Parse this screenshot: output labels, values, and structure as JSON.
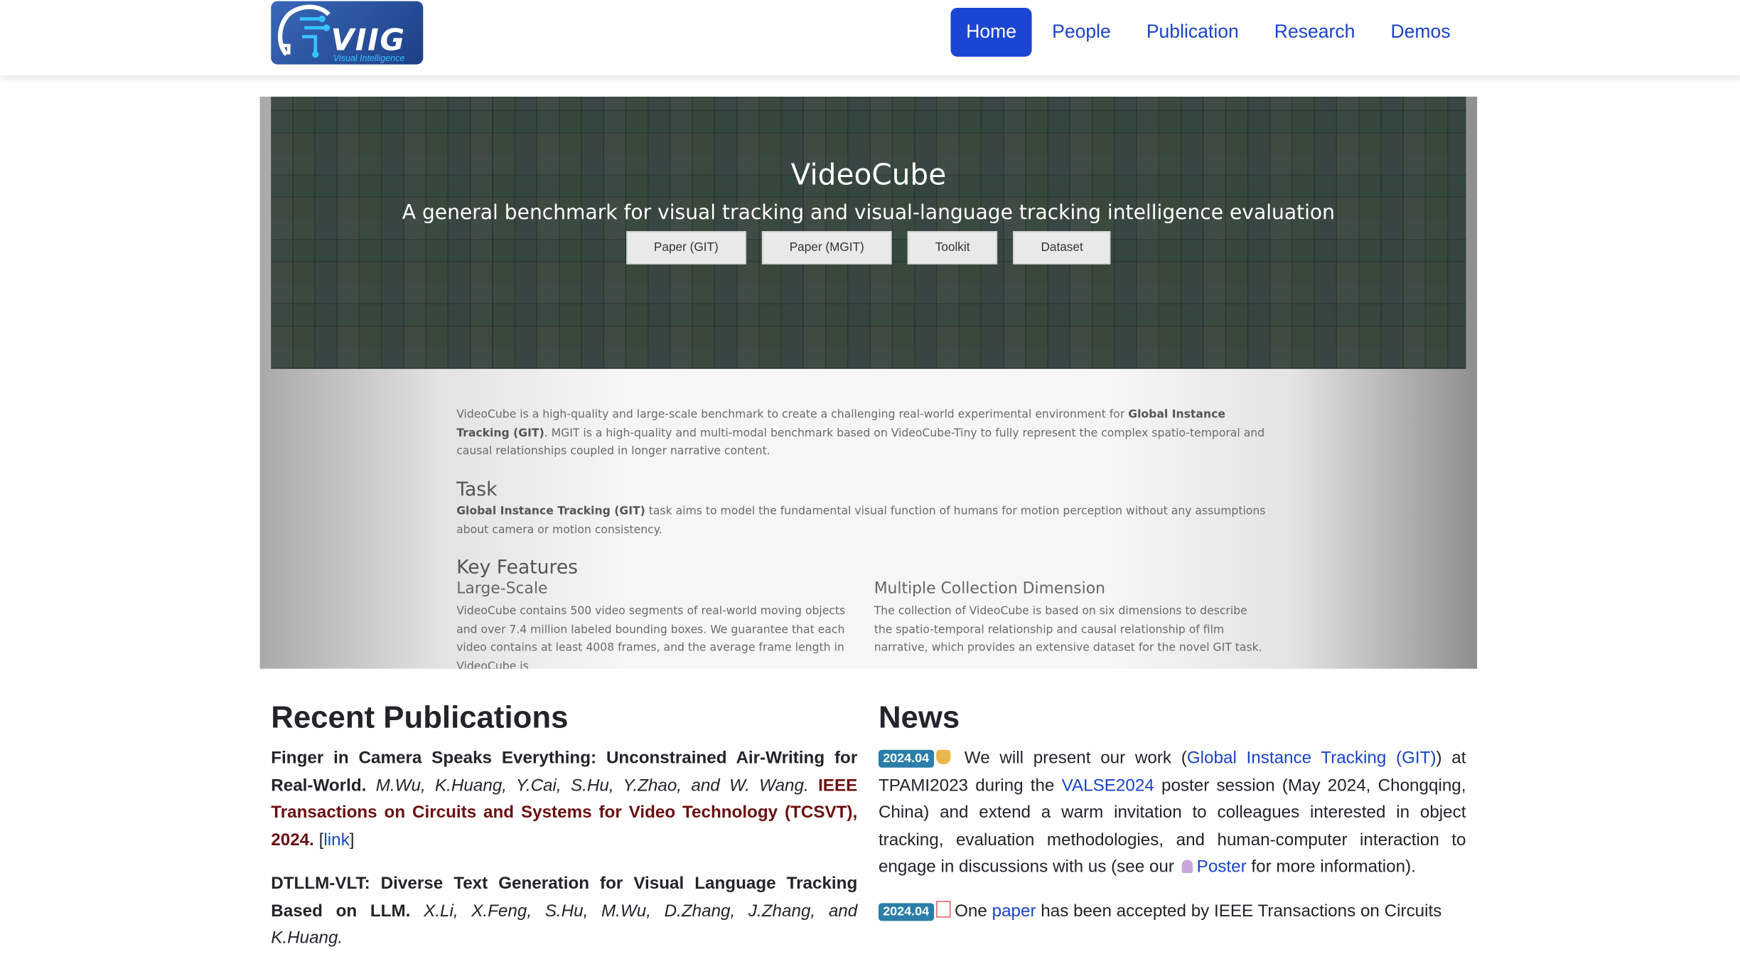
{
  "brand": {
    "logo_text": "VIIG",
    "logo_sub": "Visual Intelligence"
  },
  "nav": {
    "items": [
      "Home",
      "People",
      "Publication",
      "Research",
      "Demos"
    ],
    "active": "Home"
  },
  "banner": {
    "title": "VideoCube",
    "subtitle": "A general benchmark for visual tracking and visual-language tracking intelligence evaluation",
    "buttons": [
      "Paper (GIT)",
      "Paper (MGIT)",
      "Toolkit",
      "Dataset"
    ]
  },
  "intro": {
    "p1_a": "VideoCube is a high-quality and large-scale benchmark to create a challenging real-world experimental environment for ",
    "p1_b": "Global Instance Tracking (GIT)",
    "p1_c": ". MGIT is a high-quality and multi-modal benchmark based on VideoCube-Tiny to fully represent the complex spatio-temporal and causal relationships coupled in longer narrative content.",
    "task_heading": "Task",
    "task_b": "Global Instance Tracking (GIT)",
    "task_text": " task aims to model the fundamental visual function of humans for motion perception without any assumptions about camera or motion consistency.",
    "features_heading": "Key Features",
    "f1_title": "Large-Scale",
    "f1_text": "VideoCube contains 500 video segments of real-world moving objects and over 7.4 million labeled bounding boxes. We guarantee that each video contains at least 4008 frames, and the average frame length in VideoCube is",
    "f2_title": "Multiple Collection Dimension",
    "f2_text": "The collection of VideoCube is based on six dimensions to describe the spatio-temporal relationship and causal relationship of film narrative, which provides an extensive dataset for the novel GIT task."
  },
  "publications": {
    "heading": "Recent Publications",
    "items": [
      {
        "title": "Finger in Camera Speaks Everything: Unconstrained Air-Writing for Real-World.",
        "authors": "M.Wu, K.Huang, Y.Cai, S.Hu, Y.Zhao, and W. Wang.",
        "venue": "IEEE Transactions on Circuits and Systems for Video Technology (TCSVT), 2024.",
        "link_open": "[",
        "link_label": "link",
        "link_close": "]"
      },
      {
        "title": "DTLLM-VLT: Diverse Text Generation for Visual Language Tracking Based on LLM.",
        "authors": "X.Li, X.Feng, S.Hu, M.Wu, D.Zhang, J.Zhang, and K.Huang."
      }
    ]
  },
  "news": {
    "heading": "News",
    "items": [
      {
        "date": "2024.04",
        "t1": " We will present our work (",
        "link1": "Global Instance Tracking (GIT)",
        "t2": ") at TPAMI2023 during the ",
        "link2": "VALSE2024",
        "t3": " poster session (May 2024, Chongqing, China) and extend a warm invitation to colleagues interested in object tracking, evaluation methodologies, and human-computer interaction to engage in discussions with us (see our ",
        "link3": "Poster",
        "t4": " for more information)."
      },
      {
        "date": "2024.04",
        "t1": "One ",
        "link1": "paper",
        "t2": " has been accepted by IEEE Transactions on Circuits"
      }
    ]
  }
}
